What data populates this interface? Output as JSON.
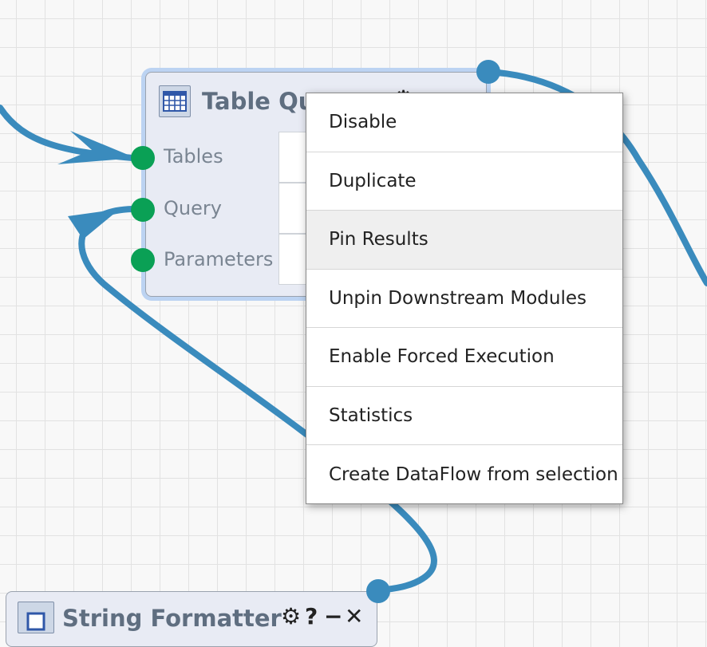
{
  "nodes": {
    "table_query": {
      "title": "Table Query",
      "ports": [
        "Tables",
        "Query",
        "Parameters"
      ],
      "icon": "table-icon"
    },
    "string_formatter": {
      "title": "String Formatter",
      "icon": "module-icon"
    }
  },
  "context_menu": {
    "items": [
      "Disable",
      "Duplicate",
      "Pin Results",
      "Unpin Downstream Modules",
      "Enable Forced Execution",
      "Statistics",
      "Create DataFlow from selection"
    ],
    "hovered_item": "Pin Results"
  },
  "colors": {
    "wire": "#3a8bbd",
    "input_port": "#0aa055",
    "selection_glow": "#bcd3f2",
    "node_title": "#5f6e80"
  }
}
